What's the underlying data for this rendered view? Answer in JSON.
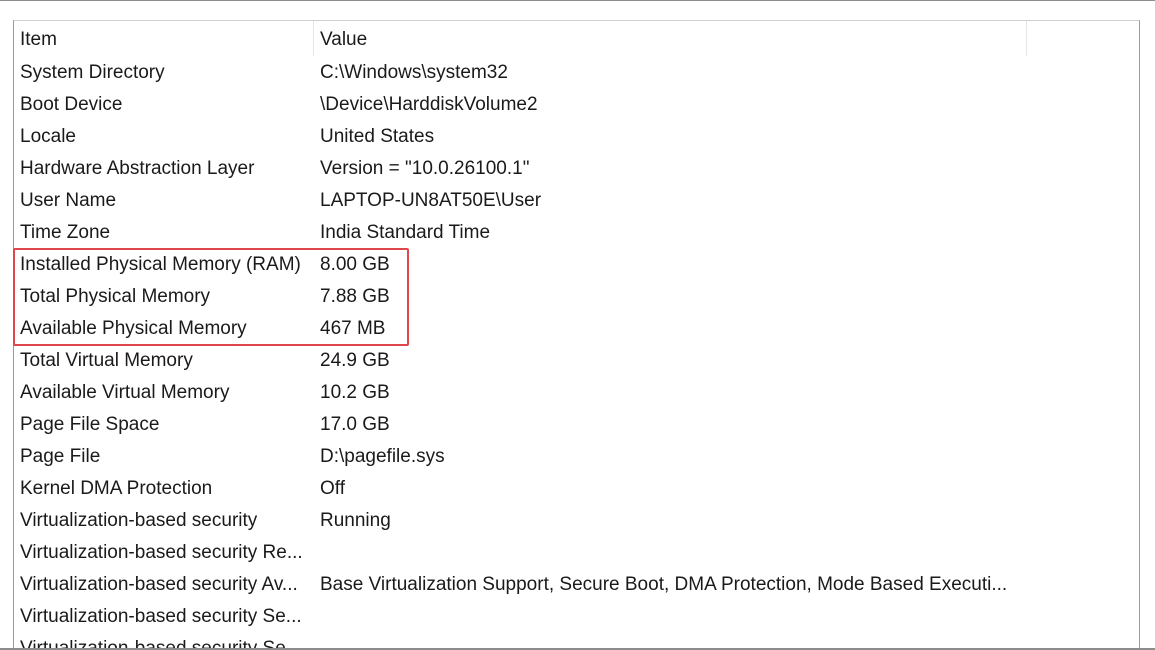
{
  "columns": {
    "item": "Item",
    "value": "Value"
  },
  "rows": [
    {
      "item": "System Directory",
      "value": "C:\\Windows\\system32"
    },
    {
      "item": "Boot Device",
      "value": "\\Device\\HarddiskVolume2"
    },
    {
      "item": "Locale",
      "value": "United States"
    },
    {
      "item": "Hardware Abstraction Layer",
      "value": "Version = \"10.0.26100.1\""
    },
    {
      "item": "User Name",
      "value": "LAPTOP-UN8AT50E\\User"
    },
    {
      "item": "Time Zone",
      "value": "India Standard Time"
    },
    {
      "item": "Installed Physical Memory (RAM)",
      "value": "8.00 GB"
    },
    {
      "item": "Total Physical Memory",
      "value": "7.88 GB"
    },
    {
      "item": "Available Physical Memory",
      "value": "467 MB"
    },
    {
      "item": "Total Virtual Memory",
      "value": "24.9 GB"
    },
    {
      "item": "Available Virtual Memory",
      "value": "10.2 GB"
    },
    {
      "item": "Page File Space",
      "value": "17.0 GB"
    },
    {
      "item": "Page File",
      "value": "D:\\pagefile.sys"
    },
    {
      "item": "Kernel DMA Protection",
      "value": "Off"
    },
    {
      "item": "Virtualization-based security",
      "value": "Running"
    },
    {
      "item": "Virtualization-based security Re...",
      "value": ""
    },
    {
      "item": "Virtualization-based security Av...",
      "value": "Base Virtualization Support, Secure Boot, DMA Protection, Mode Based Executi..."
    },
    {
      "item": "Virtualization-based security Se...",
      "value": ""
    },
    {
      "item": "Virtualization-based security Se...",
      "value": ""
    }
  ],
  "highlight": {
    "color": "#e0474c",
    "rows": [
      "Installed Physical Memory (RAM)",
      "Total Physical Memory",
      "Available Physical Memory"
    ]
  }
}
